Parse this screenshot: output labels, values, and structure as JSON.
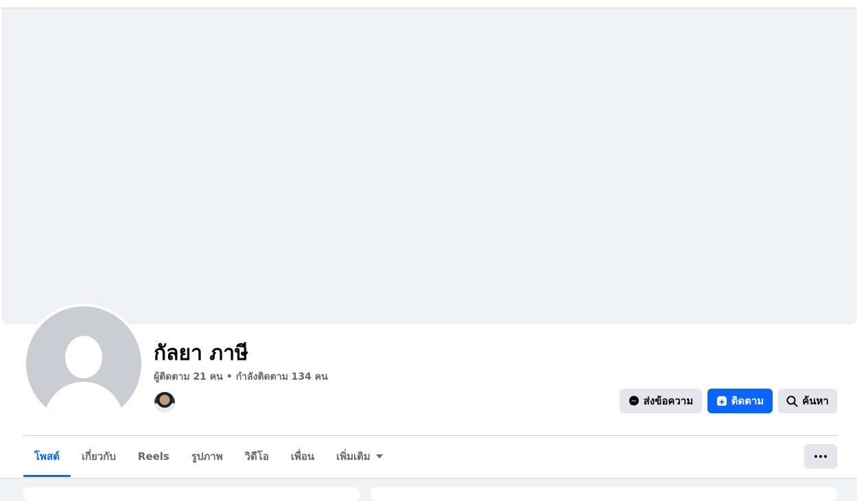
{
  "profile": {
    "name": "กัลยา ภาษี",
    "followers": "ผู้ติดตาม 21 คน",
    "separator": "•",
    "following": "กำลังติดตาม 134 คน"
  },
  "actions": {
    "message_label": "ส่งข้อความ",
    "follow_label": "ติดตาม",
    "search_label": "ค้นหา"
  },
  "tabs": [
    {
      "label": "โพสต์",
      "active": true
    },
    {
      "label": "เกี่ยวกับ",
      "active": false
    },
    {
      "label": "Reels",
      "active": false
    },
    {
      "label": "รูปภาพ",
      "active": false
    },
    {
      "label": "วิดีโอ",
      "active": false
    },
    {
      "label": "เพื่อน",
      "active": false
    },
    {
      "label": "เพิ่มเติม",
      "active": false
    }
  ],
  "icons": {
    "message": "messenger-icon",
    "follow": "follow-icon",
    "search": "search-icon",
    "more_tab": "caret-down-icon",
    "overflow": "more-options-icon"
  },
  "colors": {
    "accent": "#0866ff",
    "secondary_button": "#e4e6eb",
    "muted_text": "#65676b",
    "cover": "#f0f1f5",
    "avatar_placeholder": "#cbcdd2"
  }
}
